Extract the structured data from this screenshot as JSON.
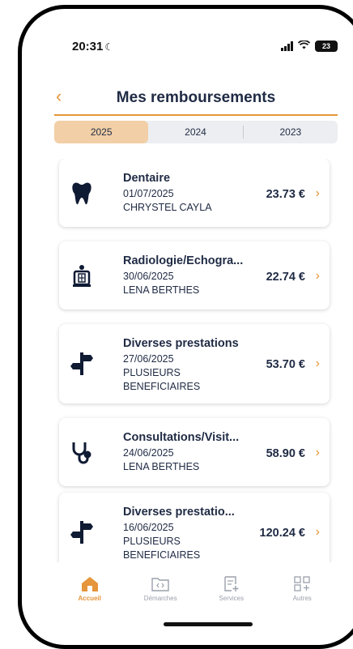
{
  "status": {
    "time": "20:31",
    "battery": "23"
  },
  "header": {
    "title": "Mes remboursements"
  },
  "years": [
    "2025",
    "2024",
    "2023"
  ],
  "active_year": "2025",
  "cards": [
    {
      "category": "Dentaire",
      "date": "01/07/2025",
      "beneficiary": [
        "CHRYSTEL CAYLA"
      ],
      "amount": "23.73 €",
      "icon": "tooth-icon"
    },
    {
      "category": "Radiologie/Echogra...",
      "date": "30/06/2025",
      "beneficiary": [
        "LENA BERTHES"
      ],
      "amount": "22.74 €",
      "icon": "radiology-icon"
    },
    {
      "category": "Diverses prestations",
      "date": "27/06/2025",
      "beneficiary": [
        "PLUSIEURS",
        "BENEFICIAIRES"
      ],
      "amount": "53.70 €",
      "icon": "signpost-icon"
    },
    {
      "category": "Consultations/Visit...",
      "date": "24/06/2025",
      "beneficiary": [
        "LENA BERTHES"
      ],
      "amount": "58.90 €",
      "icon": "stethoscope-icon"
    },
    {
      "category": "Diverses prestatio...",
      "date": "16/06/2025",
      "beneficiary": [
        "PLUSIEURS",
        "BENEFICIAIRES"
      ],
      "amount": "120.24 €",
      "icon": "signpost-icon"
    }
  ],
  "tabbar": [
    {
      "label": "Accueil",
      "icon": "home-icon",
      "active": true
    },
    {
      "label": "Démarches",
      "icon": "folder-code-icon",
      "active": false
    },
    {
      "label": "Services",
      "icon": "list-plus-icon",
      "active": false
    },
    {
      "label": "Autres",
      "icon": "grid-plus-icon",
      "active": false
    }
  ],
  "colors": {
    "accent": "#e5953a",
    "text": "#1f2a44",
    "segment_active": "#f2cfa6"
  }
}
